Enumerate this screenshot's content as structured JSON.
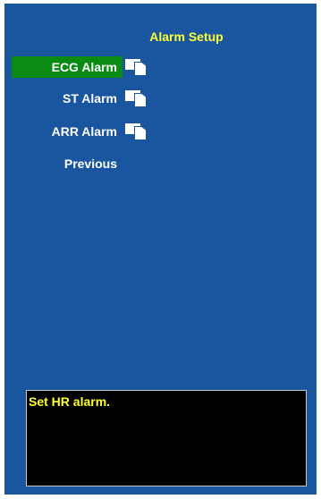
{
  "header": {
    "title": "Alarm Setup"
  },
  "menu": {
    "items": [
      {
        "label": "ECG Alarm",
        "selected": true,
        "has_submenu": true,
        "icon": "submenu-doc-icon"
      },
      {
        "label": "ST Alarm",
        "selected": false,
        "has_submenu": true,
        "icon": "submenu-doc-icon"
      },
      {
        "label": "ARR Alarm",
        "selected": false,
        "has_submenu": true,
        "icon": "submenu-doc-icon"
      },
      {
        "label": "Previous",
        "selected": false,
        "has_submenu": false
      }
    ]
  },
  "help": {
    "text": "Set HR alarm."
  },
  "colors": {
    "panel_bg": "#1a56a0",
    "selected_bg": "#0a8c14",
    "title_text": "#ffff33",
    "menu_text": "#ffffff",
    "help_bg": "#000000",
    "help_text": "#ffff33"
  }
}
